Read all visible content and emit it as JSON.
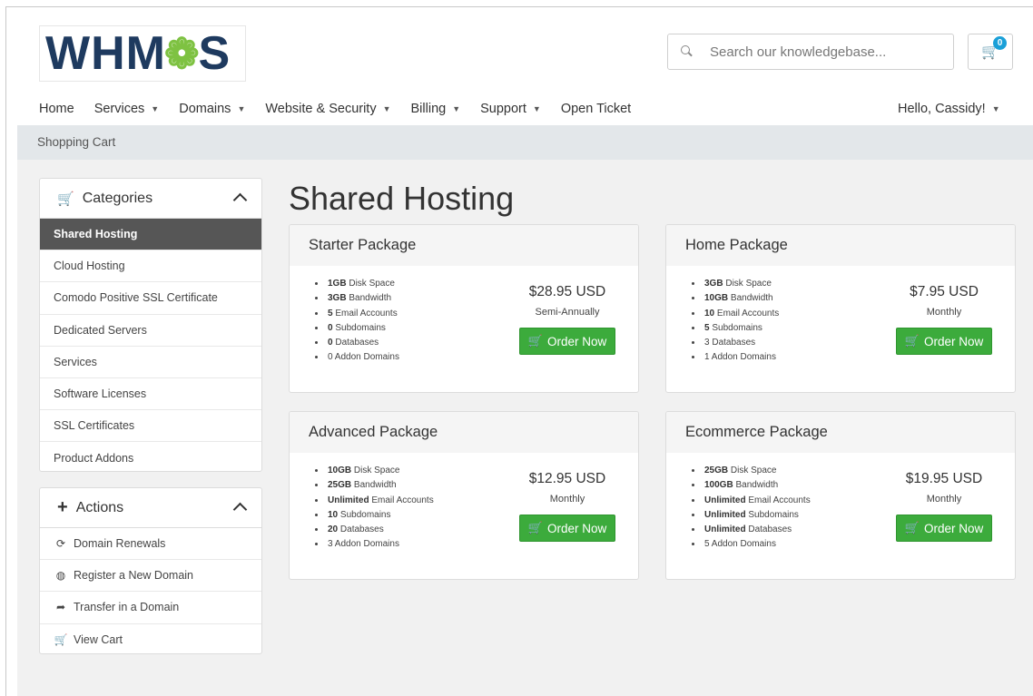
{
  "logo": {
    "text_left": "WHM",
    "text_gear": "❁",
    "text_right": "S"
  },
  "search": {
    "placeholder": "Search our knowledgebase..."
  },
  "cart": {
    "count": "0"
  },
  "nav": {
    "items": [
      {
        "label": "Home",
        "dropdown": false
      },
      {
        "label": "Services",
        "dropdown": true
      },
      {
        "label": "Domains",
        "dropdown": true
      },
      {
        "label": "Website & Security",
        "dropdown": true
      },
      {
        "label": "Billing",
        "dropdown": true
      },
      {
        "label": "Support",
        "dropdown": true
      },
      {
        "label": "Open Ticket",
        "dropdown": false
      }
    ],
    "user": "Hello, Cassidy!"
  },
  "breadcrumb": "Shopping Cart",
  "sidebar": {
    "categories": {
      "title": "Categories",
      "items": [
        "Shared Hosting",
        "Cloud Hosting",
        "Comodo Positive SSL Certificate",
        "Dedicated Servers",
        "Services",
        "Software Licenses",
        "SSL Certificates",
        "Product Addons"
      ],
      "active_index": 0
    },
    "actions": {
      "title": "Actions",
      "items": [
        {
          "label": "Domain Renewals",
          "icon": "refresh-icon"
        },
        {
          "label": "Register a New Domain",
          "icon": "globe-icon"
        },
        {
          "label": "Transfer in a Domain",
          "icon": "share-arrow-icon"
        },
        {
          "label": "View Cart",
          "icon": "cart-icon"
        }
      ]
    }
  },
  "main": {
    "title": "Shared Hosting",
    "order_label": "Order Now",
    "packages": [
      {
        "name": "Starter Package",
        "price": "$28.95 USD",
        "cycle": "Semi-Annually",
        "features": [
          {
            "value": "1GB",
            "label": "Disk Space",
            "bold": true
          },
          {
            "value": "3GB",
            "label": "Bandwidth",
            "bold": true
          },
          {
            "value": "5",
            "label": "Email Accounts",
            "bold": true
          },
          {
            "value": "0",
            "label": "Subdomains",
            "bold": true
          },
          {
            "value": "0",
            "label": "Databases",
            "bold": true
          },
          {
            "value": "0",
            "label": "Addon Domains",
            "bold": false
          }
        ]
      },
      {
        "name": "Home Package",
        "price": "$7.95 USD",
        "cycle": "Monthly",
        "features": [
          {
            "value": "3GB",
            "label": "Disk Space",
            "bold": true
          },
          {
            "value": "10GB",
            "label": "Bandwidth",
            "bold": true
          },
          {
            "value": "10",
            "label": "Email Accounts",
            "bold": true
          },
          {
            "value": "5",
            "label": "Subdomains",
            "bold": true
          },
          {
            "value": "3",
            "label": "Databases",
            "bold": false
          },
          {
            "value": "1",
            "label": "Addon Domains",
            "bold": false
          }
        ]
      },
      {
        "name": "Advanced Package",
        "price": "$12.95 USD",
        "cycle": "Monthly",
        "features": [
          {
            "value": "10GB",
            "label": "Disk Space",
            "bold": true
          },
          {
            "value": "25GB",
            "label": "Bandwidth",
            "bold": true
          },
          {
            "value": "Unlimited",
            "label": "Email Accounts",
            "bold": true
          },
          {
            "value": "10",
            "label": "Subdomains",
            "bold": true
          },
          {
            "value": "20",
            "label": "Databases",
            "bold": true
          },
          {
            "value": "3",
            "label": "Addon Domains",
            "bold": false
          }
        ]
      },
      {
        "name": "Ecommerce Package",
        "price": "$19.95 USD",
        "cycle": "Monthly",
        "features": [
          {
            "value": "25GB",
            "label": "Disk Space",
            "bold": true
          },
          {
            "value": "100GB",
            "label": "Bandwidth",
            "bold": true
          },
          {
            "value": "Unlimited",
            "label": "Email Accounts",
            "bold": true
          },
          {
            "value": "Unlimited",
            "label": "Subdomains",
            "bold": true
          },
          {
            "value": "Unlimited",
            "label": "Databases",
            "bold": true
          },
          {
            "value": "5",
            "label": "Addon Domains",
            "bold": false
          }
        ]
      }
    ]
  },
  "colors": {
    "accent_green": "#3cab3c",
    "logo_navy": "#1e3a5f",
    "logo_green": "#7ec242",
    "badge_blue": "#1aa0d8",
    "active_item": "#565656"
  }
}
